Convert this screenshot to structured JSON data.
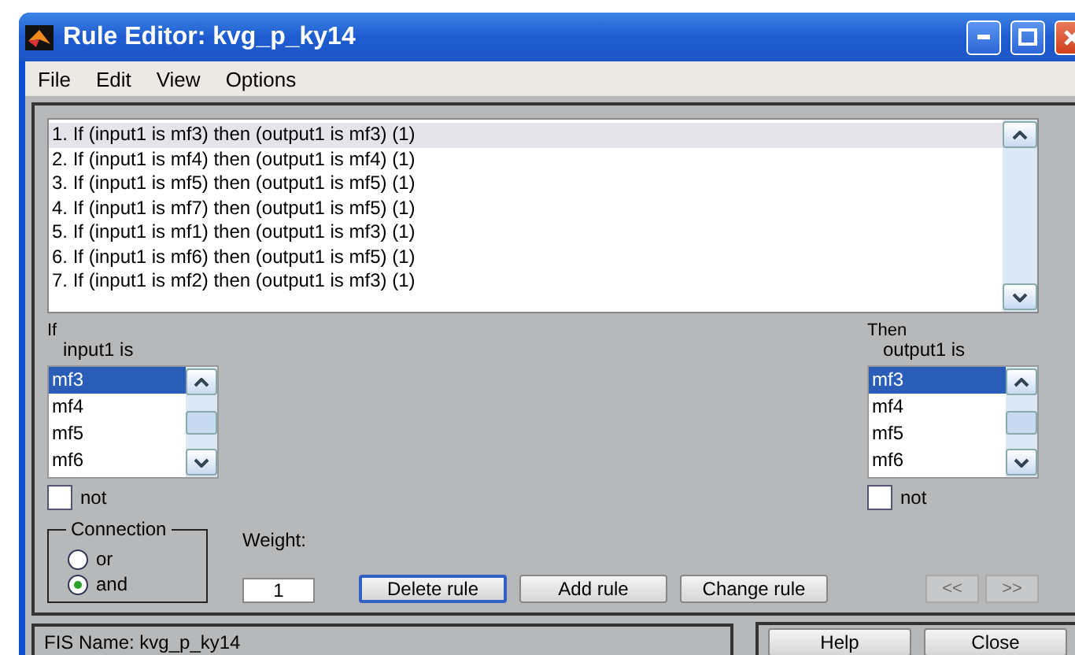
{
  "window": {
    "title": "Rule Editor: kvg_p_ky14"
  },
  "menu": [
    "File",
    "Edit",
    "View",
    "Options"
  ],
  "rules": [
    {
      "text": "1. If (input1 is mf3) then (output1 is mf3) (1)",
      "selected": true
    },
    {
      "text": "2. If (input1 is mf4) then (output1 is mf4) (1)",
      "selected": false
    },
    {
      "text": "3. If (input1 is mf5) then (output1 is mf5) (1)",
      "selected": false
    },
    {
      "text": "4. If (input1 is mf7) then (output1 is mf5) (1)",
      "selected": false
    },
    {
      "text": "5. If (input1 is mf1) then (output1 is mf3) (1)",
      "selected": false
    },
    {
      "text": "6. If (input1 is mf6) then (output1 is mf5) (1)",
      "selected": false
    },
    {
      "text": "7. If (input1 is mf2) then (output1 is mf3) (1)",
      "selected": false
    }
  ],
  "antecedent": {
    "header": "If",
    "label": "input1 is",
    "items": [
      {
        "label": "mf3",
        "selected": true
      },
      {
        "label": "mf4",
        "selected": false
      },
      {
        "label": "mf5",
        "selected": false
      },
      {
        "label": "mf6",
        "selected": false
      }
    ],
    "not_label": "not",
    "not_checked": false
  },
  "consequent": {
    "header": "Then",
    "label": "output1 is",
    "items": [
      {
        "label": "mf3",
        "selected": true
      },
      {
        "label": "mf4",
        "selected": false
      },
      {
        "label": "mf5",
        "selected": false
      },
      {
        "label": "mf6",
        "selected": false
      }
    ],
    "not_label": "not",
    "not_checked": false
  },
  "connection": {
    "title": "Connection",
    "options": [
      {
        "label": "or",
        "selected": false
      },
      {
        "label": "and",
        "selected": true
      }
    ]
  },
  "weight": {
    "label": "Weight:",
    "value": "1"
  },
  "buttons": [
    {
      "label": "Delete rule",
      "focused": true
    },
    {
      "label": "Add rule",
      "focused": false
    },
    {
      "label": "Change rule",
      "focused": false
    }
  ],
  "nav_buttons": [
    {
      "label": "<<",
      "disabled": true
    },
    {
      "label": ">>",
      "disabled": true
    }
  ],
  "status": {
    "text": "FIS Name: kvg_p_ky14"
  },
  "bottom_buttons": [
    "Help",
    "Close"
  ]
}
